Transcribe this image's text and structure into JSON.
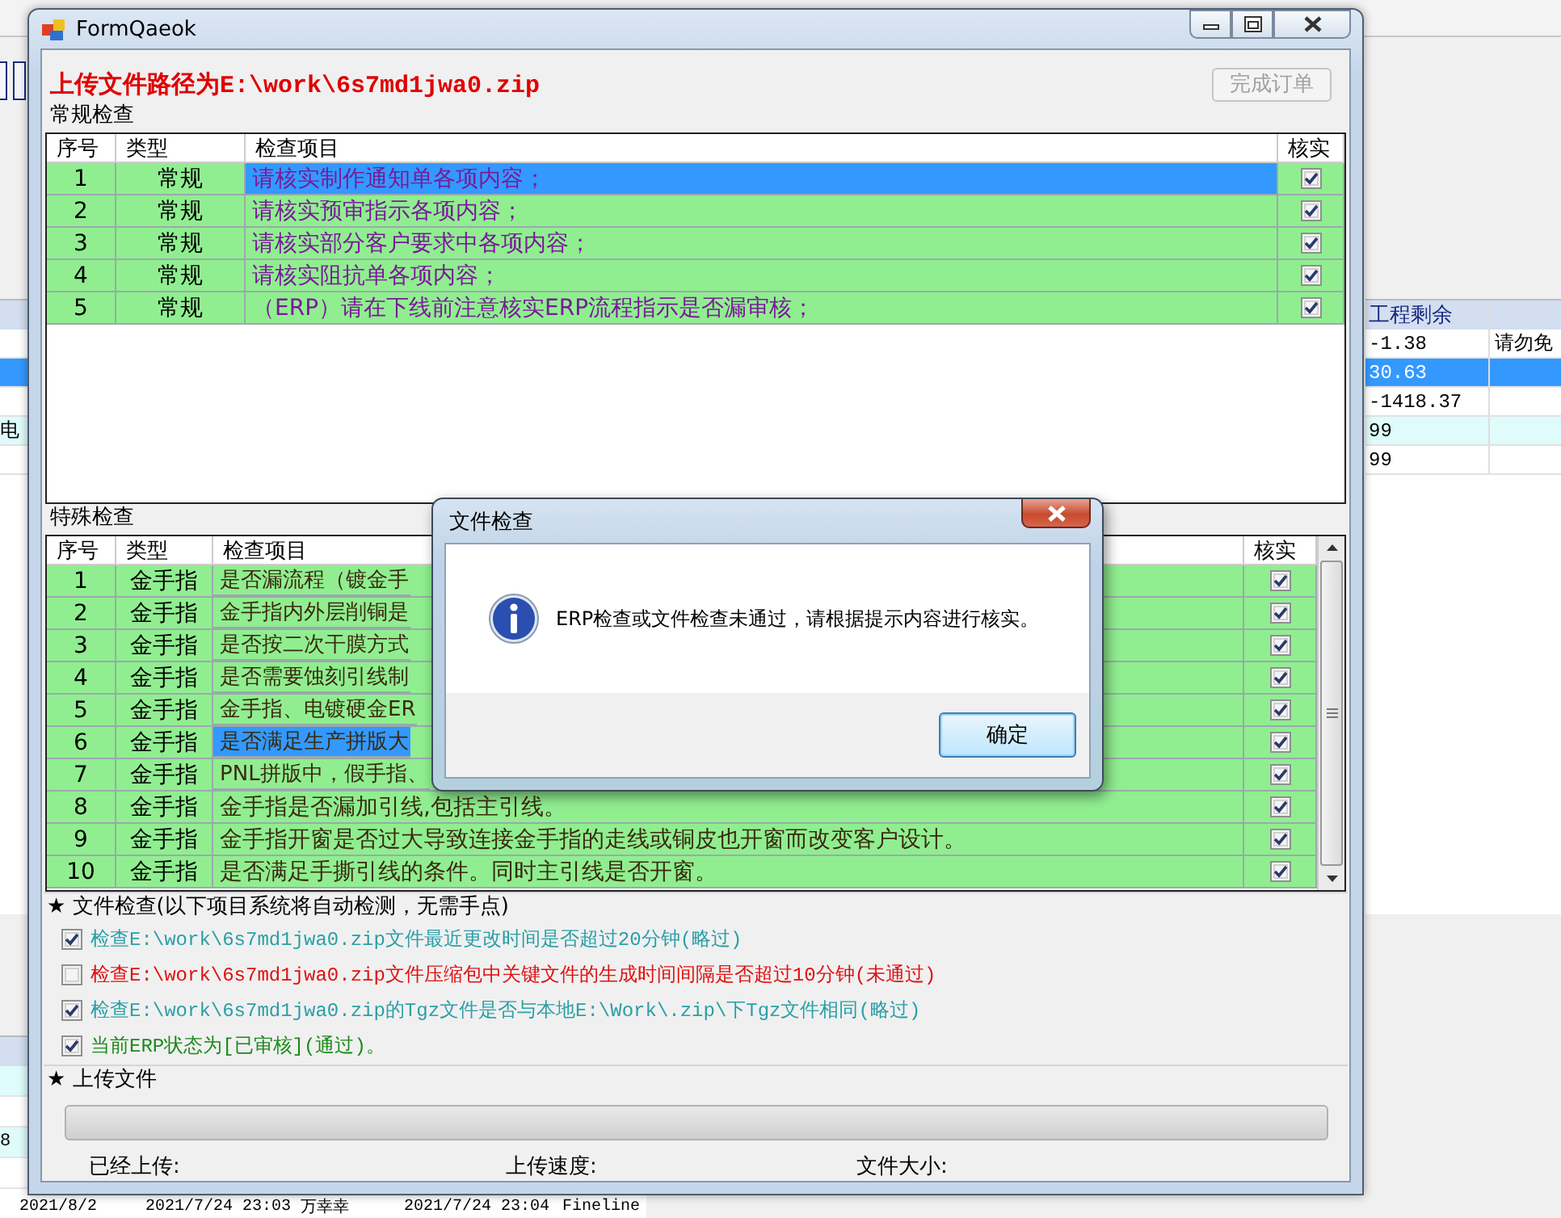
{
  "background": {
    "grid": {
      "header": "工程剩余",
      "rows": [
        {
          "selected": false,
          "remaining": "-1.38",
          "column_3": "请勿免"
        },
        {
          "selected": true,
          "remaining": "30.63"
        },
        {
          "selected": false,
          "remaining": "-1418.37"
        },
        {
          "selected": false,
          "column_1": "电",
          "remaining": "99"
        },
        {
          "selected": false,
          "remaining": "99"
        }
      ]
    },
    "lower_grid": {
      "rows": [
        {
          "cells": [
            "8"
          ]
        },
        {
          "cells": [
            "2021/8/2",
            "2021/7/24 23:03",
            "万幸幸",
            "2021/7/24 23:04",
            "Fineline"
          ]
        }
      ]
    }
  },
  "window": {
    "title": "FormQaeok",
    "upload_path": "上传文件路径为E:\\work\\6s7md1jwa0.zip",
    "complete_button": {
      "label": "完成订单",
      "disabled": true
    },
    "routine_check": {
      "title": "常规检查",
      "columns": [
        "序号",
        "类型",
        "检查项目",
        "核实"
      ],
      "rows": [
        {
          "no": "1",
          "type": "常规",
          "item": "请核实制作通知单各项内容；",
          "checked": true,
          "selected": true
        },
        {
          "no": "2",
          "type": "常规",
          "item": "请核实预审指示各项内容；",
          "checked": true,
          "selected": false
        },
        {
          "no": "3",
          "type": "常规",
          "item": "请核实部分客户要求中各项内容；",
          "checked": true,
          "selected": false
        },
        {
          "no": "4",
          "type": "常规",
          "item": "请核实阻抗单各项内容；",
          "checked": true,
          "selected": false
        },
        {
          "no": "5",
          "type": "常规",
          "item": "（ERP）请在下线前注意核实ERP流程指示是否漏审核；",
          "checked": true,
          "selected": false
        }
      ]
    },
    "special_check": {
      "title": "特殊检查",
      "columns": [
        "序号",
        "类型",
        "检查项目",
        "核实"
      ],
      "rows": [
        {
          "no": "1",
          "type": "金手指",
          "item": "是否漏流程（镀金手",
          "checked": true,
          "selected": false
        },
        {
          "no": "2",
          "type": "金手指",
          "item": "金手指内外层削铜是",
          "checked": true,
          "selected": false
        },
        {
          "no": "3",
          "type": "金手指",
          "item": "是否按二次干膜方式",
          "checked": true,
          "selected": false
        },
        {
          "no": "4",
          "type": "金手指",
          "item": "是否需要蚀刻引线制",
          "checked": true,
          "selected": false
        },
        {
          "no": "5",
          "type": "金手指",
          "item": "金手指、电镀硬金ER",
          "checked": true,
          "selected": false
        },
        {
          "no": "6",
          "type": "金手指",
          "item": "是否满足生产拼版大",
          "checked": true,
          "selected": true
        },
        {
          "no": "7",
          "type": "金手指",
          "item": "PNL拼版中，假手指、",
          "checked": true,
          "selected": false
        },
        {
          "no": "8",
          "type": "金手指",
          "item": "金手指是否漏加引线,包括主引线。",
          "checked": true,
          "selected": false
        },
        {
          "no": "9",
          "type": "金手指",
          "item": "金手指开窗是否过大导致连接金手指的走线或铜皮也开窗而改变客户设计。",
          "checked": true,
          "selected": false
        },
        {
          "no": "10",
          "type": "金手指",
          "item": "是否满足手撕引线的条件。同时主引线是否开窗。",
          "checked": true,
          "selected": false
        }
      ]
    },
    "file_check": {
      "title": "★ 文件检查(以下项目系统将自动检测，无需手点)",
      "items": [
        {
          "text": "检查E:\\work\\6s7md1jwa0.zip文件最近更改时间是否超过20分钟(略过)",
          "checked": true,
          "color": "#2a9fa6"
        },
        {
          "text": "检查E:\\work\\6s7md1jwa0.zip文件压缩包中关键文件的生成时间间隔是否超过10分钟(未通过)",
          "checked": false,
          "color": "#e01010"
        },
        {
          "text": "检查E:\\work\\6s7md1jwa0.zip的Tgz文件是否与本地E:\\Work\\.zip\\下Tgz文件相同(略过)",
          "checked": true,
          "color": "#2a9fa6"
        },
        {
          "text": "当前ERP状态为[已审核](通过)。",
          "checked": true,
          "color": "#1a8a1a"
        }
      ]
    },
    "upload": {
      "title": "★ 上传文件",
      "level": 0,
      "labels": [
        "已经上传:",
        "上传速度:",
        "文件大小:"
      ]
    }
  },
  "dialog": {
    "title": "文件检查",
    "message": "ERP检查或文件检查未通过，请根据提示内容进行核实。",
    "buttons": [
      "确定"
    ]
  }
}
